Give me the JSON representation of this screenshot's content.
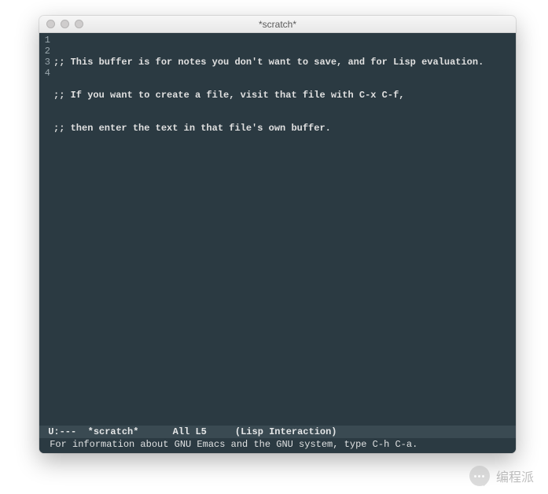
{
  "window": {
    "title": "*scratch*"
  },
  "buffer": {
    "lines": [
      ";; This buffer is for notes you don't want to save, and for Lisp evaluation.",
      ";; If you want to create a file, visit that file with C-x C-f,",
      ";; then enter the text in that file's own buffer.",
      ""
    ],
    "line_numbers": [
      "1",
      "2",
      "3",
      "4"
    ]
  },
  "modeline": {
    "status": "U:---",
    "buffer_name": "*scratch*",
    "position": "All",
    "line": "L5",
    "mode": "(Lisp Interaction)"
  },
  "minibuffer": {
    "message": "For information about GNU Emacs and the GNU system, type C-h C-a."
  },
  "watermark": {
    "text": "编程派"
  }
}
